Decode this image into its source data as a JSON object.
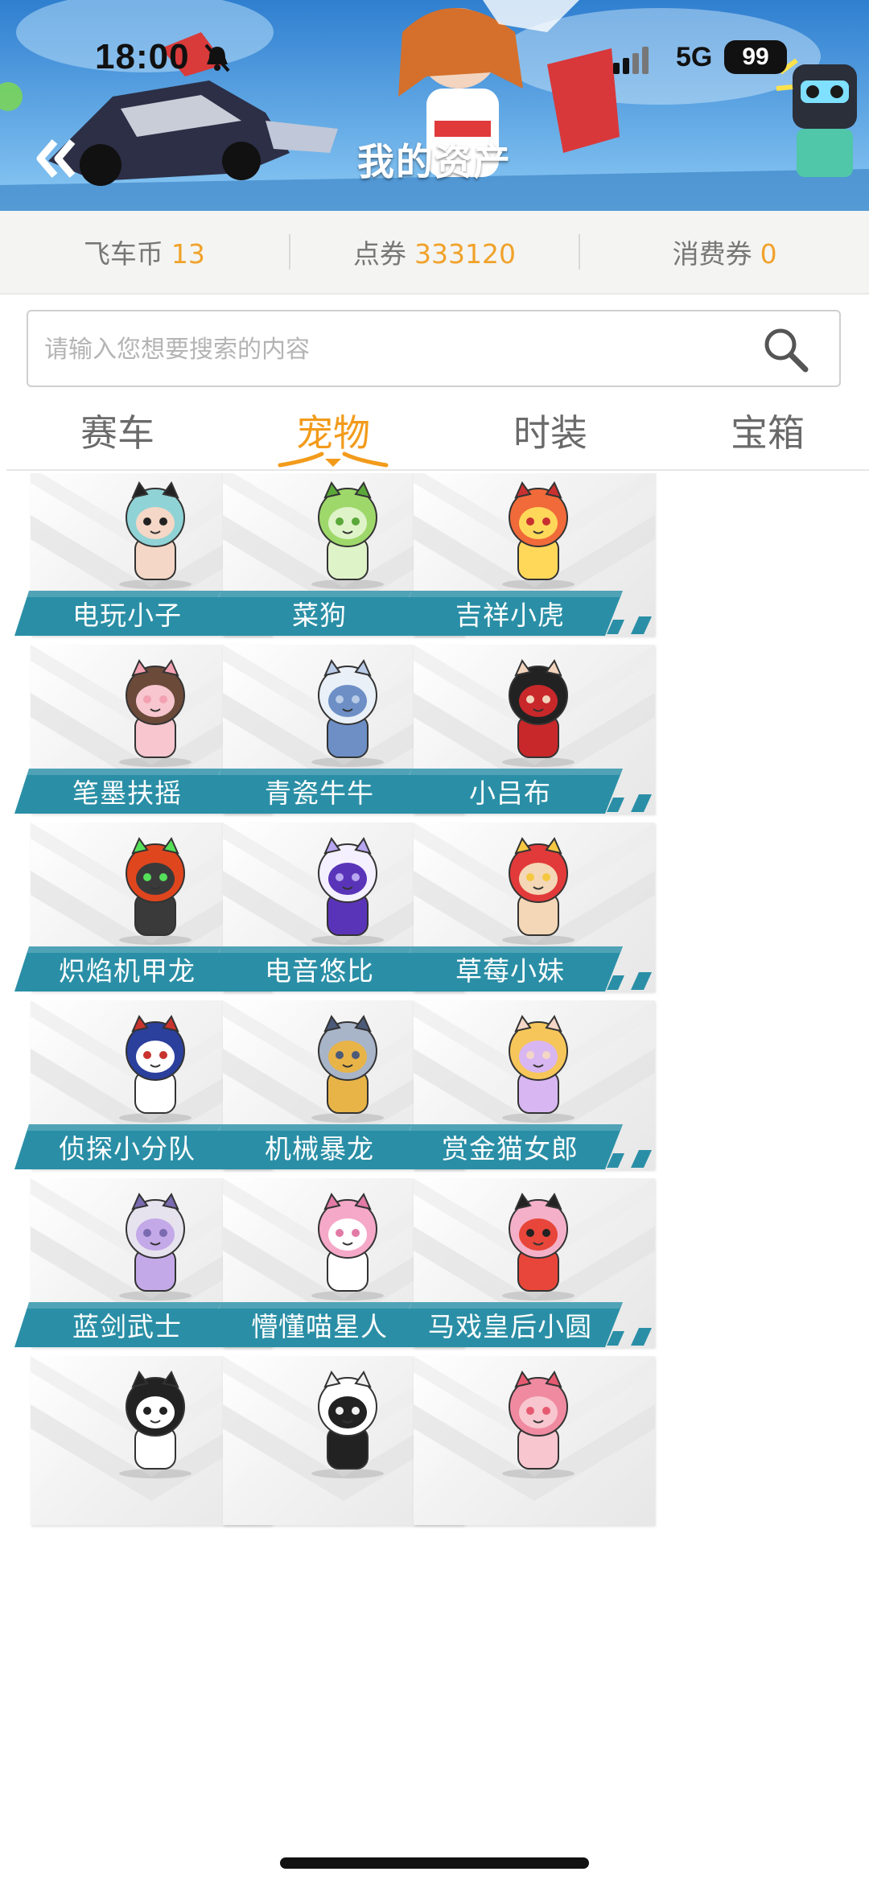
{
  "status_bar": {
    "time": "18:00",
    "network": "5G",
    "battery": "99"
  },
  "header": {
    "title": "我的资产"
  },
  "currencies": [
    {
      "label": "飞车币",
      "amount": "13"
    },
    {
      "label": "点券",
      "amount": "333120"
    },
    {
      "label": "消费券",
      "amount": "0"
    }
  ],
  "search": {
    "placeholder": "请输入您想要搜索的内容",
    "value": ""
  },
  "tabs": [
    {
      "label": "赛车",
      "active": false
    },
    {
      "label": "宠物",
      "active": true
    },
    {
      "label": "时装",
      "active": false
    },
    {
      "label": "宝箱",
      "active": false
    }
  ],
  "pets": [
    {
      "name": "电玩小子",
      "icon": "gamer-boy-icon",
      "colors": [
        "#8fd3d6",
        "#f4d7c6",
        "#222222"
      ]
    },
    {
      "name": "菜狗",
      "icon": "cabbage-dog-icon",
      "colors": [
        "#9ed86a",
        "#dff3c8",
        "#5aa83a"
      ]
    },
    {
      "name": "吉祥小虎",
      "icon": "lucky-tiger-icon",
      "colors": [
        "#f06a3a",
        "#ffd85a",
        "#c93030"
      ]
    },
    {
      "name": "笔墨扶摇",
      "icon": "ink-girl-icon",
      "colors": [
        "#6b4a3a",
        "#f7c6cf",
        "#f3a0b0"
      ]
    },
    {
      "name": "青瓷牛牛",
      "icon": "porcelain-ox-icon",
      "colors": [
        "#e9f0f7",
        "#6d8fc6",
        "#b9cbe6"
      ]
    },
    {
      "name": "小吕布",
      "icon": "little-lubu-icon",
      "colors": [
        "#222222",
        "#c8282a",
        "#f2d4bd"
      ]
    },
    {
      "name": "炽焰机甲龙",
      "icon": "flame-mech-dragon-icon",
      "colors": [
        "#e0461e",
        "#3a3a3a",
        "#55e05a"
      ]
    },
    {
      "name": "电音悠比",
      "icon": "electro-yoobi-icon",
      "colors": [
        "#f4f0ff",
        "#5a34b8",
        "#b7a6f0"
      ]
    },
    {
      "name": "草莓小妹",
      "icon": "strawberry-girl-icon",
      "colors": [
        "#e23a3a",
        "#f4d7b6",
        "#f6c842"
      ]
    },
    {
      "name": "侦探小分队",
      "icon": "detective-squad-icon",
      "colors": [
        "#2b3f9c",
        "#ffffff",
        "#c9332e"
      ]
    },
    {
      "name": "机械暴龙",
      "icon": "mech-trex-icon",
      "colors": [
        "#a8b4c8",
        "#e8b448",
        "#4b5a78"
      ]
    },
    {
      "name": "赏金猫女郎",
      "icon": "bounty-cat-girl-icon",
      "colors": [
        "#f7c65a",
        "#d8b6f2",
        "#f4d6c6"
      ]
    },
    {
      "name": "蓝剑武士",
      "icon": "blue-sword-warrior-icon",
      "colors": [
        "#e6e3ef",
        "#c4a9e8",
        "#7a6ab0"
      ]
    },
    {
      "name": "懵懂喵星人",
      "icon": "confused-cat-icon",
      "colors": [
        "#f5a8c8",
        "#ffffff",
        "#e27aa6"
      ]
    },
    {
      "name": "马戏皇后小圆",
      "icon": "circus-queen-icon",
      "colors": [
        "#f4b0c8",
        "#e8463a",
        "#222222"
      ]
    },
    {
      "name": "",
      "icon": "panda-bear-icon",
      "colors": [
        "#222222",
        "#ffffff",
        "#222222"
      ]
    },
    {
      "name": "",
      "icon": "panda-cub-icon",
      "colors": [
        "#ffffff",
        "#222222",
        "#f0f0f0"
      ]
    },
    {
      "name": "",
      "icon": "pink-bun-icon",
      "colors": [
        "#f08aa0",
        "#f7c6cf",
        "#e65a70"
      ]
    }
  ],
  "colors": {
    "accent": "#f29b1b",
    "banner_teal": "#2a8fa6",
    "amount": "#f0a22a"
  }
}
